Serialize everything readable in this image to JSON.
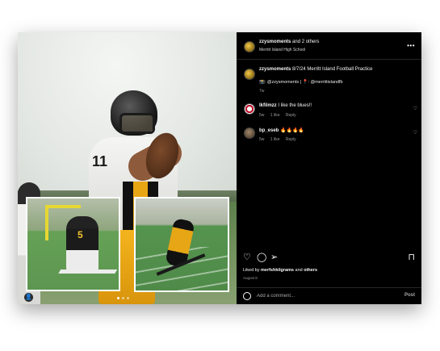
{
  "header": {
    "username": "zzysmoments",
    "others": " and 2 others",
    "location": "Merritt Island High School",
    "more_icon": "more-horizontal-icon"
  },
  "caption": {
    "username": "zzysmoments",
    "text": " 8/7/24 Merritt Island Football Practice",
    "line2": "📸: @zzysmoments | 📍: @merrittislandfb",
    "time": "7w"
  },
  "comments": [
    {
      "username": "lkfilmzz",
      "text": " I like the blues!!",
      "time": "5w",
      "likes": "1 like",
      "reply": "Reply"
    },
    {
      "username": "bp_eseb",
      "text": " 🔥🔥🔥🔥",
      "time": "5w",
      "likes": "1 like",
      "reply": "Reply"
    }
  ],
  "liked_by": {
    "prefix": "Liked by ",
    "user": "merfshkilgrams",
    "suffix": " and ",
    "others": "others"
  },
  "date": "August 8",
  "comment_box": {
    "placeholder": "Add a comment...",
    "post_label": "Post"
  },
  "inset_number": "5",
  "main_jersey_number": "11",
  "colors": {
    "background": "#000000",
    "team_gold": "#e8a514"
  }
}
